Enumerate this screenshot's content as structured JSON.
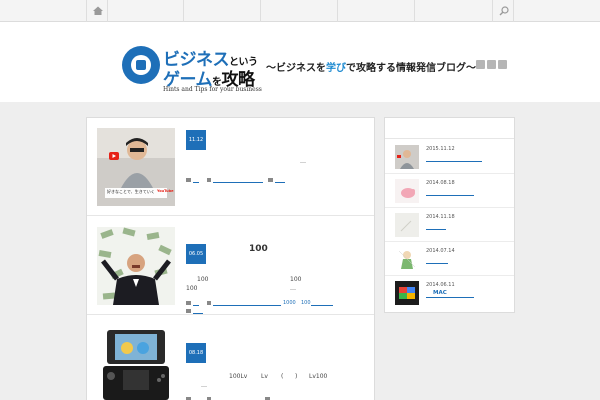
{
  "nav": {
    "home_icon": "home-icon",
    "search_icon": "search-icon"
  },
  "header": {
    "logo_line1_main": "ビジネス",
    "logo_line1_small": "という",
    "logo_line2_main": "ゲーム",
    "logo_line2_small": "を",
    "logo_line2_end": "攻略",
    "logo_tagline": "Hints and Tips for your business",
    "tagline_pre": "〜ビジネスを",
    "tagline_highlight": "学び",
    "tagline_post": "で攻略する情報発信ブログ〜",
    "social_icons": [
      "rss-icon",
      "twitter-icon",
      "facebook-icon"
    ]
  },
  "posts": [
    {
      "date": "11.12",
      "title": "",
      "excerpt_lines": [
        "…"
      ],
      "meta_tags": [],
      "thumb_caption": "好きなことで、生きていく",
      "thumb_logo": "YouTube"
    },
    {
      "date": "06.05",
      "title": "100",
      "excerpt_lines": [
        "100",
        "100",
        "100",
        "…"
      ],
      "meta_tags": [
        "1000",
        "100"
      ],
      "thumb_caption": "",
      "thumb_logo": ""
    },
    {
      "date": "08.18",
      "title": "",
      "excerpt_lines": [
        "100Lv",
        "Lv",
        "(",
        ")",
        "Lv100",
        "…"
      ],
      "meta_tags": [],
      "thumb_caption": "",
      "thumb_logo": ""
    }
  ],
  "sidebar": {
    "items": [
      {
        "date": "2015.11.12",
        "title": ""
      },
      {
        "date": "2014.08.18",
        "title": ""
      },
      {
        "date": "2014.11.18",
        "title": ""
      },
      {
        "date": "2014.07.14",
        "title": ""
      },
      {
        "date": "2014.06.11",
        "title": "MAC"
      }
    ]
  }
}
